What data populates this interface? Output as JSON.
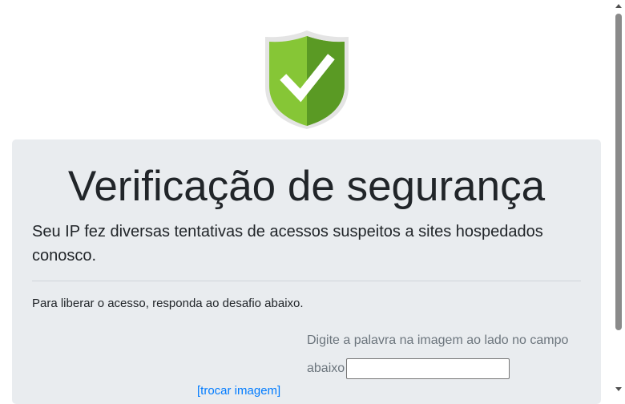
{
  "header": {
    "logo_icon": "shield-check-icon",
    "colors": {
      "shield_light": "#8fce3a",
      "shield_dark": "#4f8f1e",
      "shield_border": "#e2e2e2"
    }
  },
  "main": {
    "title": "Verificação de segurança",
    "lead": "Seu IP fez diversas tentativas de acessos suspeitos a sites hospedados conosco.",
    "instructions": "Para liberar o acesso, responda ao desafio abaixo.",
    "captcha": {
      "hint": "Digite a palavra na imagem ao lado no campo abaixo",
      "input_value": "",
      "swap_link": "[trocar imagem]"
    }
  },
  "colors": {
    "panel_bg": "#e9ecef",
    "link": "#007bff",
    "muted_text": "#6c757d"
  }
}
